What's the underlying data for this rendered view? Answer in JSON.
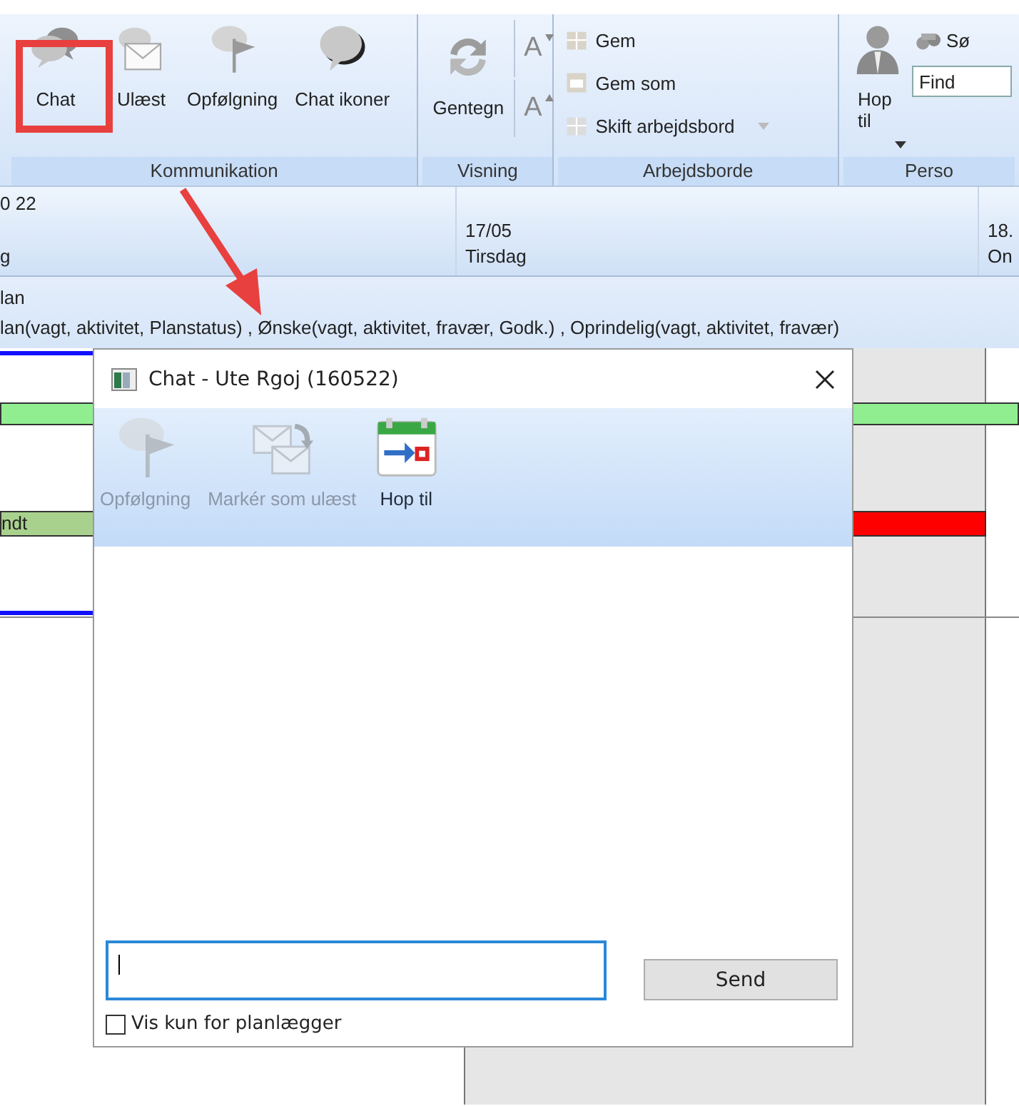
{
  "ribbon": {
    "groups": [
      {
        "label": "Kommunikation",
        "columns": [
          [
            {
              "kind": "large",
              "label": "Chat"
            }
          ],
          [
            {
              "kind": "large",
              "label": "Ulæst"
            }
          ],
          [
            {
              "kind": "large",
              "label": "Opfølgning"
            }
          ],
          [
            {
              "kind": "large",
              "label": "Chat ikoner"
            }
          ]
        ]
      },
      {
        "label": "Visning",
        "columns": [
          [
            {
              "kind": "large",
              "label": "Gentegn"
            }
          ],
          [
            {
              "kind": "glyph",
              "label": "A"
            },
            {
              "kind": "glyph",
              "label": "A"
            }
          ]
        ]
      },
      {
        "label": "Arbejdsborde",
        "columns": [
          [
            {
              "kind": "small",
              "label": "Gem"
            },
            {
              "kind": "small",
              "label": "Gem som"
            },
            {
              "kind": "small",
              "label": "Skift arbejdsbord",
              "dropdown": true
            }
          ]
        ]
      },
      {
        "label": "Perso",
        "columns": [
          [
            {
              "kind": "large",
              "label": "Hop til",
              "dropdown": true
            }
          ],
          [
            {
              "kind": "small",
              "label": "Sø"
            },
            {
              "kind": "field",
              "placeholder": "Find"
            }
          ]
        ]
      }
    ]
  },
  "header": {
    "left_top": "0 22",
    "left_bottom": "g",
    "days": [
      {
        "date": "17/05",
        "day": "Tirsdag"
      },
      {
        "date": "18.",
        "day": "On"
      }
    ]
  },
  "legend": [
    "lan",
    "lan(vagt, aktivitet, Planstatus) , Ønske(vagt, aktivitet, fravær, Godk.) , Oprindelig(vagt, aktivitet, fravær)"
  ],
  "bars": [
    {
      "kind": "full",
      "color": "#90ee90"
    },
    {
      "kind": "left",
      "label": "ndt",
      "color": "#a9d18e"
    },
    {
      "kind": "right",
      "color": "#ff0000"
    }
  ],
  "dialog": {
    "title": "Chat - Ute Rgoj (160522)",
    "toolbar": [
      {
        "label": "Opfølgning",
        "disabled": true
      },
      {
        "label": "Markér som ulæst",
        "disabled": true
      },
      {
        "label": "Hop til",
        "disabled": false
      }
    ],
    "message": {
      "focused": true
    },
    "send": "Send",
    "only_planner": {
      "label": "Vis kun for planlægger",
      "checked": false
    }
  }
}
